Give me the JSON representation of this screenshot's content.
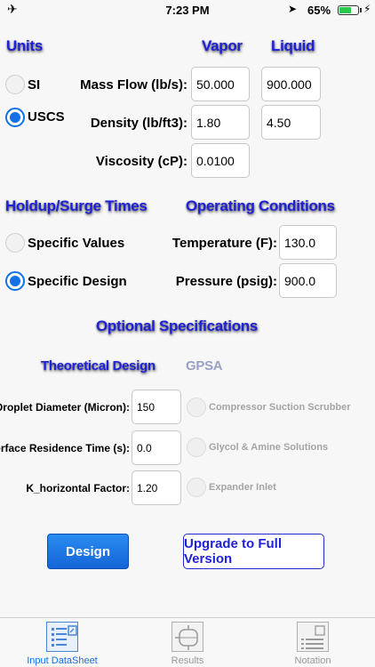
{
  "status_bar": {
    "time": "7:23 PM",
    "battery": "65%",
    "battery_level": 0.65
  },
  "units": {
    "heading": "Units",
    "options": [
      {
        "label": "SI",
        "selected": false
      },
      {
        "label": "USCS",
        "selected": true
      }
    ]
  },
  "columns": {
    "vapor": "Vapor",
    "liquid": "Liquid"
  },
  "flow": {
    "mass_flow_label": "Mass Flow (lb/s):",
    "density_label": "Density (lb/ft3):",
    "viscosity_label": "Viscosity (cP):",
    "vapor_mass_flow": "50.000",
    "liquid_mass_flow": "900.000",
    "vapor_density": "1.80",
    "liquid_density": "4.50",
    "vapor_viscosity": "0.0100"
  },
  "holdup": {
    "heading": "Holdup/Surge Times",
    "options": [
      {
        "label": "Specific Values",
        "selected": false
      },
      {
        "label": "Specific Design",
        "selected": true
      }
    ]
  },
  "operating": {
    "heading": "Operating Conditions",
    "temperature_label": "Temperature (F):",
    "temperature": "130.0",
    "pressure_label": "Pressure (psig):",
    "pressure": "900.0"
  },
  "optional": {
    "heading": "Optional Specifications",
    "theoretical_heading": "Theoretical Design",
    "gpsa_heading": "GPSA",
    "droplet_label": "Droplet Diameter (Micron):",
    "droplet": "150",
    "interface_label": "Interface Residence Time (s):",
    "interface": "0.0",
    "k_label": "K_horizontal Factor:",
    "k_factor": "1.20",
    "gpsa_options": [
      "Compressor Suction Scrubber",
      "Glycol & Amine Solutions",
      "Expander Inlet"
    ]
  },
  "buttons": {
    "design": "Design",
    "upgrade": "Upgrade to Full Version"
  },
  "tabs": [
    {
      "label": "Input DataSheet",
      "active": true,
      "icon": "datasheet-icon"
    },
    {
      "label": "Results",
      "active": false,
      "icon": "vessel-icon"
    },
    {
      "label": "Notation",
      "active": false,
      "icon": "notation-icon"
    }
  ]
}
